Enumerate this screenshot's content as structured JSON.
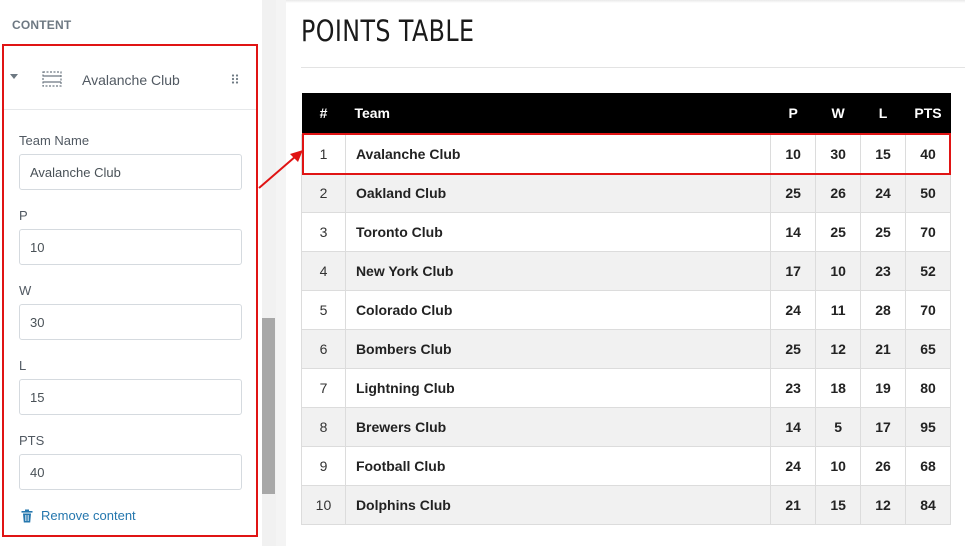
{
  "panel": {
    "header": "CONTENT",
    "item_title": "Avalanche Club",
    "fields": {
      "team_name": {
        "label": "Team Name",
        "value": "Avalanche Club"
      },
      "p": {
        "label": "P",
        "value": "10"
      },
      "w": {
        "label": "W",
        "value": "30"
      },
      "l": {
        "label": "L",
        "value": "15"
      },
      "pts": {
        "label": "PTS",
        "value": "40"
      }
    },
    "remove_label": "Remove content"
  },
  "preview": {
    "title": "POINTS TABLE",
    "columns": [
      "#",
      "Team",
      "P",
      "W",
      "L",
      "PTS"
    ],
    "rows": [
      [
        "1",
        "Avalanche Club",
        "10",
        "30",
        "15",
        "40"
      ],
      [
        "2",
        "Oakland Club",
        "25",
        "26",
        "24",
        "50"
      ],
      [
        "3",
        "Toronto Club",
        "14",
        "25",
        "25",
        "70"
      ],
      [
        "4",
        "New York Club",
        "17",
        "10",
        "23",
        "52"
      ],
      [
        "5",
        "Colorado Club",
        "24",
        "11",
        "28",
        "70"
      ],
      [
        "6",
        "Bombers Club",
        "25",
        "12",
        "21",
        "65"
      ],
      [
        "7",
        "Lightning Club",
        "23",
        "18",
        "19",
        "80"
      ],
      [
        "8",
        "Brewers Club",
        "14",
        "5",
        "17",
        "95"
      ],
      [
        "9",
        "Football Club",
        "24",
        "10",
        "26",
        "68"
      ],
      [
        "10",
        "Dolphins Club",
        "21",
        "15",
        "12",
        "84"
      ]
    ]
  },
  "colors": {
    "highlight": "#e01414",
    "link": "#2577ae",
    "table_header_bg": "#000000",
    "alt_row_bg": "#f1f1f1"
  },
  "icons": {
    "section": "section-icon",
    "drag": "drag-handle-icon",
    "remove": "trash-icon",
    "collapse": "caret-down-icon"
  }
}
